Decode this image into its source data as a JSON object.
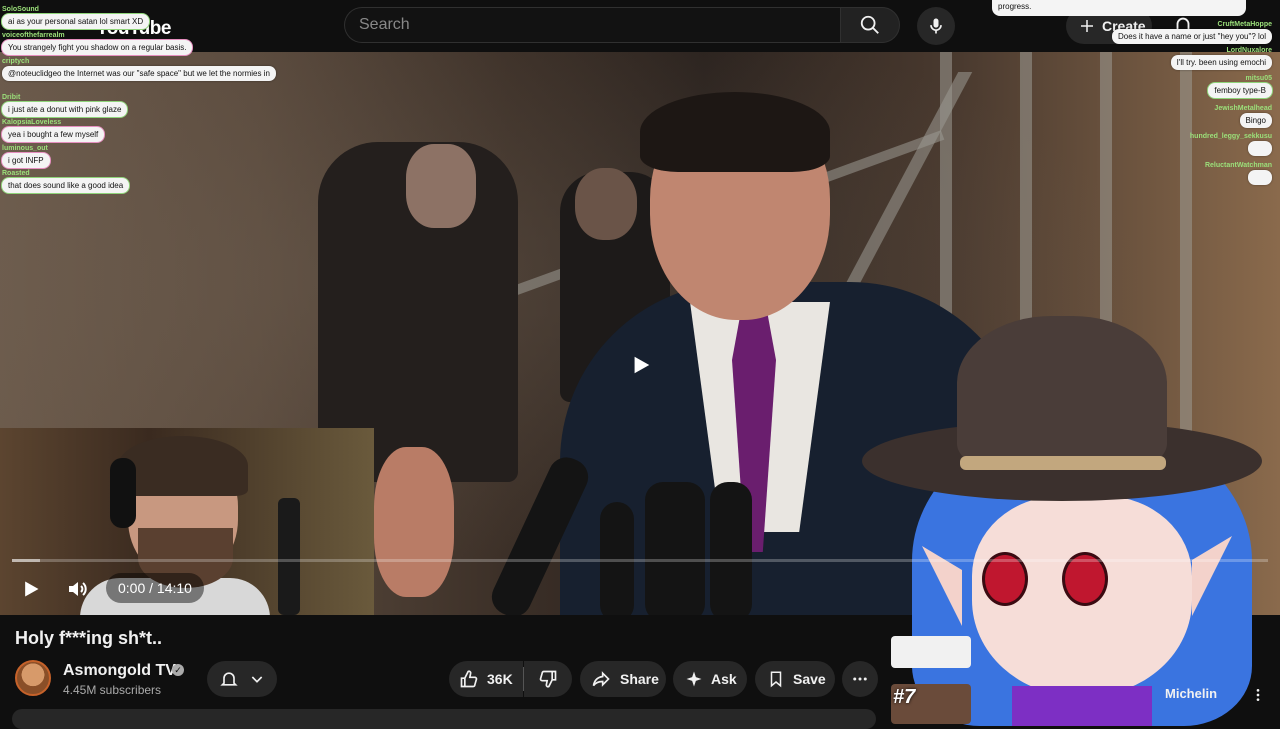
{
  "header": {
    "logo_text": "YouTube",
    "search_placeholder": "Search",
    "create_label": "Create"
  },
  "player": {
    "time": "0:00 / 14:10",
    "progress_fraction": 0.0
  },
  "video": {
    "title": "Holy f***ing sh*t..",
    "channel_name": "Asmongold TV",
    "subscribers": "4.45M subscribers",
    "likes": "36K",
    "share_label": "Share",
    "ask_label": "Ask",
    "save_label": "Save"
  },
  "recommended": {
    "rank_label": "#7",
    "partial_title": "Michelin"
  },
  "chat_left": [
    {
      "user": "SoloSound",
      "message": "ai as your personal satan lol smart XD"
    },
    {
      "user": "voiceofthefarrealm",
      "message": "You strangely fight you shadow on a regular basis."
    },
    {
      "user": "criptych",
      "message": "@noteuclidgeo the Internet was our \"safe space\" but we let the normies in"
    },
    {
      "user": "Dribit",
      "message": "i just ate a donut with pink glaze"
    },
    {
      "user": "KalopsiaLoveless",
      "message": "yea i bought a few myself"
    },
    {
      "user": "luminous_out",
      "message": "i got INFP"
    },
    {
      "user": "Roasted",
      "message": "that does sound like a good idea"
    }
  ],
  "chat_right": [
    {
      "user": "",
      "message": "progress."
    },
    {
      "user": "CruftMetaHoppe",
      "message": "Does it have a name or just \"hey you\"? lol"
    },
    {
      "user": "LordNuxalore",
      "message": "I'll try. been using emochi"
    },
    {
      "user": "mitsu05",
      "message": "femboy type-B"
    },
    {
      "user": "JewishMetalhead",
      "message": "Bingo"
    },
    {
      "user": "hundred_leggy_sekkusu",
      "message": ""
    },
    {
      "user": "ReluctantWatchman",
      "message": ""
    }
  ],
  "icons": {
    "search": "search-icon",
    "mic": "mic-icon",
    "create": "plus-icon",
    "bell": "bell-icon",
    "play": "play-icon",
    "volume": "volume-icon",
    "like": "thumbs-up-icon",
    "dislike": "thumbs-down-icon",
    "share": "share-icon",
    "ask": "sparkle-icon",
    "save": "bookmark-icon",
    "more": "more-horiz-icon"
  }
}
